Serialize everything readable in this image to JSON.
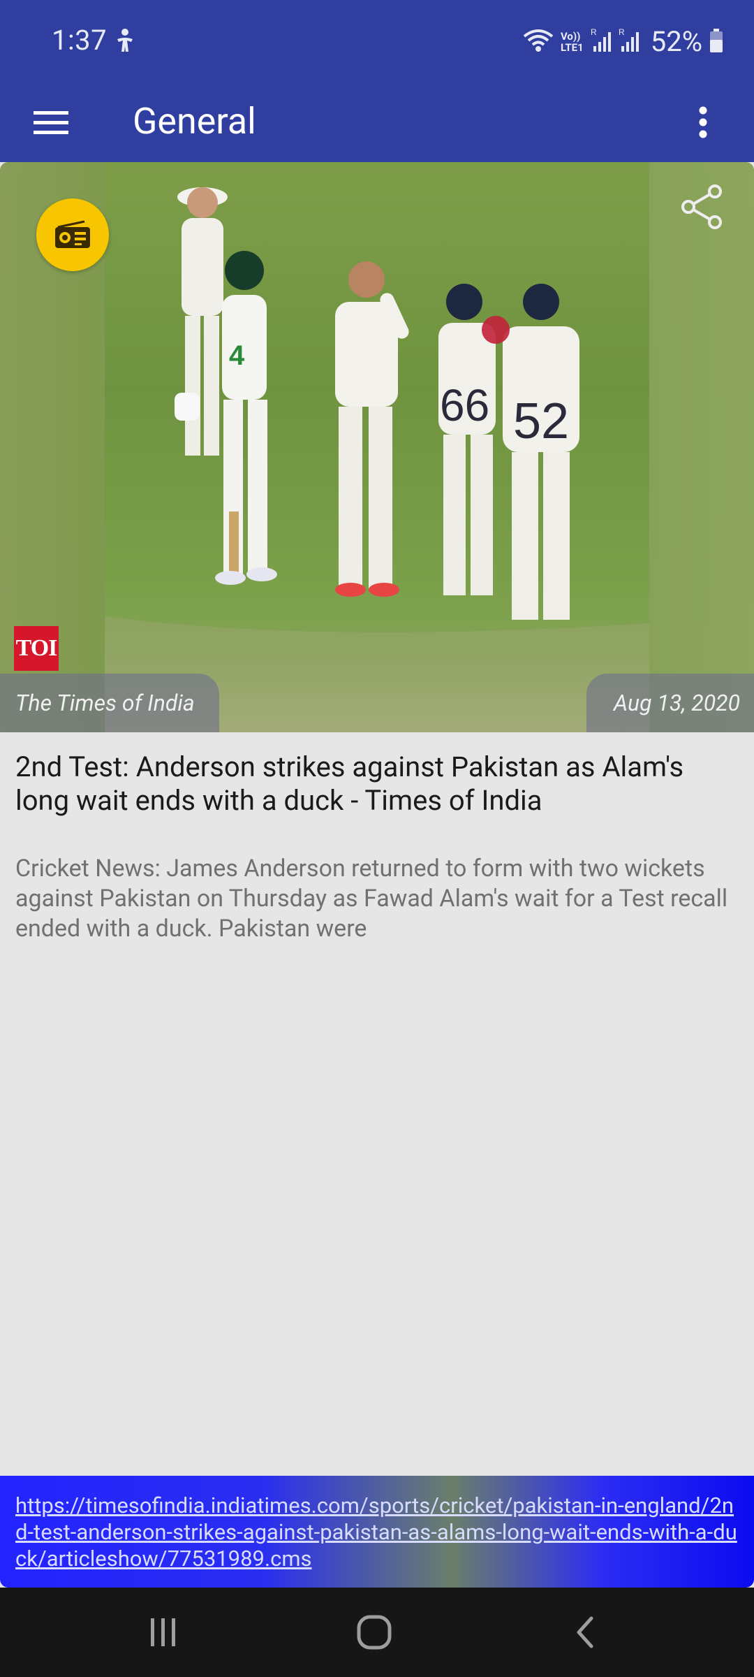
{
  "status_bar": {
    "time": "1:37",
    "network_label_top": "Vo))",
    "network_label_bottom": "LTE1",
    "battery": "52%"
  },
  "app_bar": {
    "title": "General",
    "menu_icon": "hamburger-menu-icon",
    "overflow_icon": "more-vert-icon"
  },
  "article": {
    "source": "The Times of India",
    "source_logo_text": "TOI",
    "date": "Aug 13, 2020",
    "headline": "2nd Test: Anderson strikes against Pakistan as Alam's long wait ends with a duck - Times of India",
    "summary": "Cricket News: James Anderson returned to form with two wickets against Pakistan on Thursday as Fawad Alam's wait for a Test recall ended with a duck. Pakistan were",
    "url": "https://timesofindia.indiatimes.com/sports/cricket/pakistan-in-england/2nd-test-anderson-strikes-against-pakistan-as-alams-long-wait-ends-with-a-duck/articleshow/77531989.cms",
    "radio_icon": "radio-icon",
    "share_icon": "share-icon"
  },
  "colors": {
    "primary": "#303f9f",
    "radio_fab": "#f7c600",
    "toi_red": "#d6172b",
    "url_bar": "#2323ff"
  }
}
